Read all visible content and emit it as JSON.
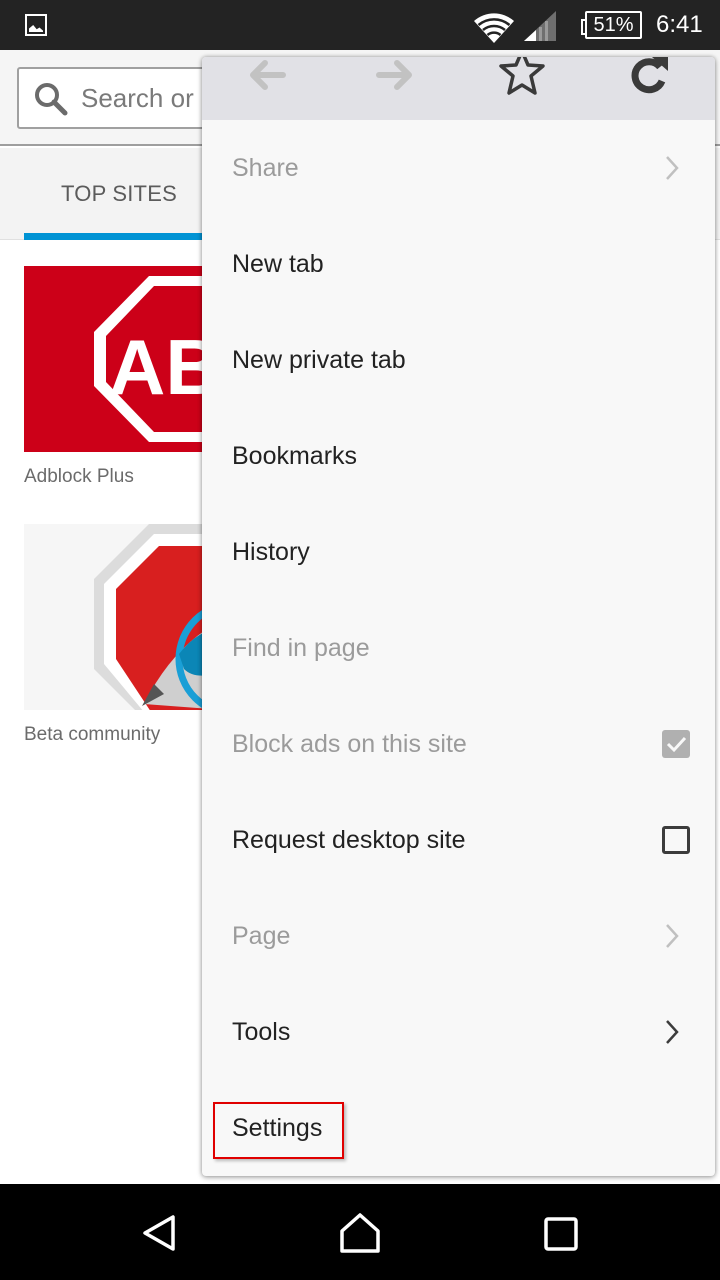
{
  "status_bar": {
    "notification_icon": "gallery-icon",
    "wifi_icon": "wifi-icon",
    "signal_icon": "cell-signal-icon",
    "battery": "51%",
    "time": "6:41"
  },
  "toolbar": {
    "search_placeholder": "Search or enter address",
    "search_icon": "search-icon"
  },
  "home": {
    "active_tab": "TOP SITES",
    "accent_color": "#0093d4",
    "top_sites": [
      {
        "title": "Adblock Plus",
        "thumb_text": "AB"
      },
      {
        "title": "Beta community"
      }
    ]
  },
  "menu": {
    "nav_icons": [
      "back-arrow-icon",
      "forward-arrow-icon",
      "bookmark-star-icon",
      "reload-icon"
    ],
    "items": [
      {
        "label": "Share",
        "enabled": false,
        "trailing": "chevron"
      },
      {
        "label": "New tab",
        "enabled": true,
        "trailing": "none"
      },
      {
        "label": "New private tab",
        "enabled": true,
        "trailing": "none"
      },
      {
        "label": "Bookmarks",
        "enabled": true,
        "trailing": "none"
      },
      {
        "label": "History",
        "enabled": true,
        "trailing": "none"
      },
      {
        "label": "Find in page",
        "enabled": false,
        "trailing": "none"
      },
      {
        "label": "Block ads on this site",
        "enabled": false,
        "trailing": "checkbox",
        "checked": true
      },
      {
        "label": "Request desktop site",
        "enabled": true,
        "trailing": "checkbox",
        "checked": false
      },
      {
        "label": "Page",
        "enabled": false,
        "trailing": "chevron"
      },
      {
        "label": "Tools",
        "enabled": true,
        "trailing": "chevron"
      },
      {
        "label": "Settings",
        "enabled": true,
        "trailing": "none",
        "highlighted": true
      }
    ],
    "highlight_color": "#e00000"
  },
  "nav_bar": {
    "icons": [
      "back-triangle-icon",
      "home-icon",
      "recents-square-icon"
    ]
  }
}
